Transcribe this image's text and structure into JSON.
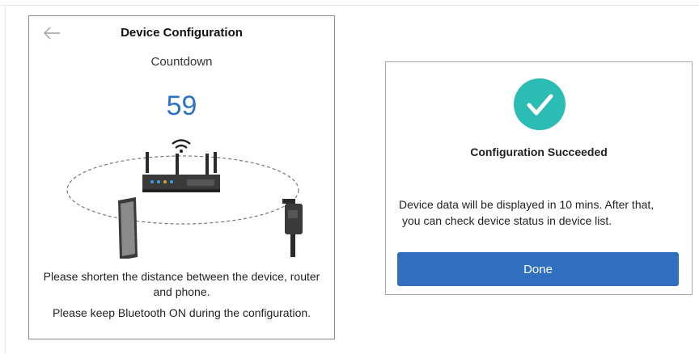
{
  "left_screen": {
    "title": "Device Configuration",
    "countdown_label": "Countdown",
    "countdown_value": "59",
    "instruction_1": "Please shorten the distance between the device, router and phone.",
    "instruction_2": "Please keep Bluetooth ON during the configuration.",
    "icons": [
      "back-arrow-icon",
      "router-icon",
      "wifi-icon",
      "phone-icon",
      "dongle-device-icon"
    ]
  },
  "right_screen": {
    "title": "Configuration Succeeded",
    "message_line_1": "Device data will be displayed in 10 mins. After that,",
    "message_line_2": "you can check device status in device list.",
    "done_label": "Done",
    "icons": [
      "success-check-icon"
    ]
  },
  "colors": {
    "countdown": "#2c73c8",
    "success_check": "#2bbcb4",
    "done_button": "#2f6fbd"
  }
}
